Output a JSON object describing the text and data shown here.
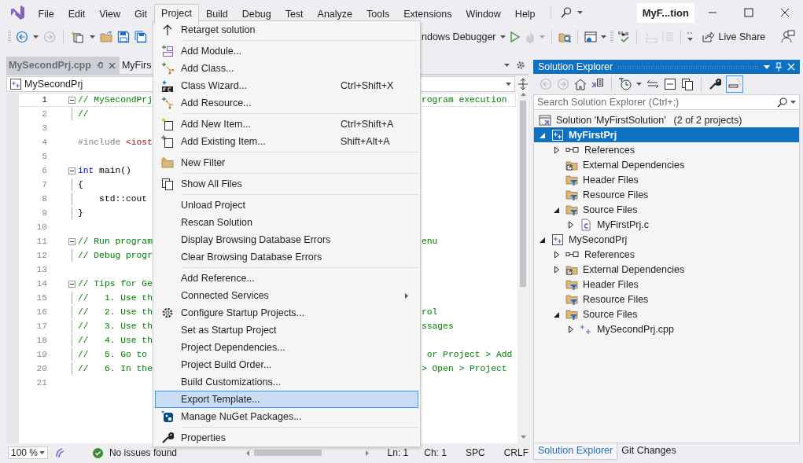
{
  "title_bar": {
    "menus": [
      {
        "label": "File",
        "selected": false
      },
      {
        "label": "Edit",
        "selected": false
      },
      {
        "label": "View",
        "selected": false
      },
      {
        "label": "Git",
        "selected": false
      },
      {
        "label": "Project",
        "selected": true
      },
      {
        "label": "Build",
        "selected": false
      },
      {
        "label": "Debug",
        "selected": false
      },
      {
        "label": "Test",
        "selected": false
      },
      {
        "label": "Analyze",
        "selected": false
      },
      {
        "label": "Tools",
        "selected": false
      },
      {
        "label": "Extensions",
        "selected": false
      },
      {
        "label": "Window",
        "selected": false
      },
      {
        "label": "Help",
        "selected": false
      }
    ],
    "title": "MyF...tion"
  },
  "toolbar": {
    "debug_target": "ndows Debugger",
    "live_share": "Live Share"
  },
  "document_tabs": [
    {
      "label": "MySecondPrj.cpp",
      "selected": true
    },
    {
      "label": "MyFirs",
      "selected": false
    }
  ],
  "navigation_bar": {
    "scope": "MySecondPrj"
  },
  "editor": {
    "lines": [
      {
        "number": "1",
        "current": true,
        "fold": true,
        "left": [
          {
            "text": "// MySecondPrj",
            "kind": "comment"
          }
        ],
        "right": [
          {
            "text": "rogram execution",
            "kind": "comment"
          }
        ]
      },
      {
        "number": "2",
        "current": false,
        "fold": false,
        "left": [
          {
            "text": "//",
            "kind": "comment"
          }
        ]
      },
      {
        "number": "3",
        "current": false,
        "fold": false
      },
      {
        "number": "4",
        "current": false,
        "fold": false,
        "left": [
          {
            "text": "#include ",
            "kind": "preprocessor"
          },
          {
            "text": "<iost",
            "kind": "string"
          }
        ]
      },
      {
        "number": "5",
        "current": false,
        "fold": false
      },
      {
        "number": "6",
        "current": false,
        "fold": true,
        "left": [
          {
            "text": "int",
            "kind": "keyword"
          },
          {
            "text": " main()",
            "kind": "plain"
          }
        ]
      },
      {
        "number": "7",
        "current": false,
        "fold": false,
        "left": [
          {
            "text": "{",
            "kind": "plain"
          }
        ]
      },
      {
        "number": "8",
        "current": false,
        "fold": false,
        "left": [
          {
            "text": "    std::cout",
            "kind": "plain"
          }
        ]
      },
      {
        "number": "9",
        "current": false,
        "fold": false,
        "left": [
          {
            "text": "}",
            "kind": "plain"
          }
        ]
      },
      {
        "number": "10",
        "current": false,
        "fold": false
      },
      {
        "number": "11",
        "current": false,
        "fold": true,
        "left": [
          {
            "text": "// Run program",
            "kind": "comment"
          }
        ],
        "right": [
          {
            "text": "enu",
            "kind": "comment"
          }
        ]
      },
      {
        "number": "12",
        "current": false,
        "fold": false,
        "left": [
          {
            "text": "// Debug progr",
            "kind": "comment"
          }
        ]
      },
      {
        "number": "13",
        "current": false,
        "fold": false
      },
      {
        "number": "14",
        "current": false,
        "fold": true,
        "left": [
          {
            "text": "// Tips for Ge",
            "kind": "comment"
          }
        ]
      },
      {
        "number": "15",
        "current": false,
        "fold": false,
        "left": [
          {
            "text": "//   1. Use th",
            "kind": "comment"
          }
        ]
      },
      {
        "number": "16",
        "current": false,
        "fold": false,
        "left": [
          {
            "text": "//   2. Use th",
            "kind": "comment"
          }
        ],
        "right": [
          {
            "text": "rol",
            "kind": "comment"
          }
        ]
      },
      {
        "number": "17",
        "current": false,
        "fold": false,
        "left": [
          {
            "text": "//   3. Use th",
            "kind": "comment"
          }
        ],
        "right": [
          {
            "text": "ssages",
            "kind": "comment"
          }
        ]
      },
      {
        "number": "18",
        "current": false,
        "fold": false,
        "left": [
          {
            "text": "//   4. Use th",
            "kind": "comment"
          }
        ]
      },
      {
        "number": "19",
        "current": false,
        "fold": false,
        "left": [
          {
            "text": "//   5. Go to",
            "kind": "comment"
          }
        ],
        "right": [
          {
            "text": " or Project > Add",
            "kind": "comment"
          }
        ]
      },
      {
        "number": "20",
        "current": false,
        "fold": false,
        "left": [
          {
            "text": "//   6. In the",
            "kind": "comment"
          }
        ],
        "right": [
          {
            "text": "> Open > Project",
            "kind": "comment"
          }
        ]
      },
      {
        "number": "21",
        "current": false,
        "fold": false
      }
    ]
  },
  "status_bar": {
    "zoom": "100 %",
    "issues": "No issues found",
    "line": "Ln: 1",
    "column": "Ch: 1",
    "indent": "SPC",
    "line_ending": "CRLF"
  },
  "project_menu": {
    "items": [
      {
        "kind": "item",
        "label": "Retarget solution",
        "submenu": false,
        "selected": false
      },
      {
        "kind": "separator"
      },
      {
        "kind": "item",
        "label": "Add Module...",
        "submenu": false,
        "selected": false
      },
      {
        "kind": "item",
        "label": "Add Class...",
        "submenu": false,
        "selected": false
      },
      {
        "kind": "item",
        "label": "Class Wizard...",
        "shortcut": "Ctrl+Shift+X",
        "submenu": false,
        "selected": false
      },
      {
        "kind": "item",
        "label": "Add Resource...",
        "submenu": false,
        "selected": false
      },
      {
        "kind": "separator"
      },
      {
        "kind": "item",
        "label": "Add New Item...",
        "shortcut": "Ctrl+Shift+A",
        "submenu": false,
        "selected": false
      },
      {
        "kind": "item",
        "label": "Add Existing Item...",
        "shortcut": "Shift+Alt+A",
        "submenu": false,
        "selected": false
      },
      {
        "kind": "separator"
      },
      {
        "kind": "item",
        "label": "New Filter",
        "submenu": false,
        "selected": false
      },
      {
        "kind": "separator"
      },
      {
        "kind": "item",
        "label": "Show All Files",
        "submenu": false,
        "selected": false
      },
      {
        "kind": "separator"
      },
      {
        "kind": "item",
        "label": "Unload Project",
        "submenu": false,
        "selected": false
      },
      {
        "kind": "item",
        "label": "Rescan Solution",
        "submenu": false,
        "selected": false
      },
      {
        "kind": "item",
        "label": "Display Browsing Database Errors",
        "submenu": false,
        "selected": false
      },
      {
        "kind": "item",
        "label": "Clear Browsing Database Errors",
        "submenu": false,
        "selected": false
      },
      {
        "kind": "separator"
      },
      {
        "kind": "item",
        "label": "Add Reference...",
        "submenu": false,
        "selected": false
      },
      {
        "kind": "item",
        "label": "Connected Services",
        "submenu": true,
        "selected": false
      },
      {
        "kind": "item",
        "label": "Configure Startup Projects...",
        "submenu": false,
        "selected": false
      },
      {
        "kind": "item",
        "label": "Set as Startup Project",
        "submenu": false,
        "selected": false
      },
      {
        "kind": "item",
        "label": "Project Dependencies...",
        "submenu": false,
        "selected": false
      },
      {
        "kind": "item",
        "label": "Project Build Order...",
        "submenu": false,
        "selected": false
      },
      {
        "kind": "item",
        "label": "Build Customizations...",
        "submenu": false,
        "selected": false
      },
      {
        "kind": "item",
        "label": "Export Template...",
        "submenu": false,
        "selected": true
      },
      {
        "kind": "item",
        "label": "Manage NuGet Packages...",
        "submenu": false,
        "selected": false
      },
      {
        "kind": "separator"
      },
      {
        "kind": "item",
        "label": "Properties",
        "submenu": false,
        "selected": false
      }
    ]
  },
  "solution_explorer": {
    "title": "Solution Explorer",
    "search": {
      "placeholder": "Search Solution Explorer (Ctrl+;)"
    },
    "tree": [
      {
        "label": "Solution 'MyFirstSolution'",
        "detail": "(2 of 2 projects)",
        "kind": "solution",
        "selected": false,
        "children": [
          {
            "label": "MyFirstPrj",
            "kind": "project",
            "startup_project": true,
            "expanded": true,
            "selected": true,
            "children": [
              {
                "label": "References",
                "kind": "references",
                "expanded": false,
                "selected": false
              },
              {
                "label": "External Dependencies",
                "kind": "external",
                "selected": false
              },
              {
                "label": "Header Files",
                "kind": "filter",
                "selected": false
              },
              {
                "label": "Resource Files",
                "kind": "filter",
                "selected": false
              },
              {
                "label": "Source Files",
                "kind": "filter",
                "expanded": true,
                "selected": false,
                "children": [
                  {
                    "label": "MyFirstPrj.c",
                    "kind": "file_c",
                    "expanded": false,
                    "selected": false
                  }
                ]
              }
            ]
          },
          {
            "label": "MySecondPrj",
            "kind": "project",
            "startup_project": false,
            "expanded": true,
            "selected": false,
            "children": [
              {
                "label": "References",
                "kind": "references",
                "expanded": false,
                "selected": false
              },
              {
                "label": "External Dependencies",
                "kind": "external",
                "expanded": false,
                "selected": false
              },
              {
                "label": "Header Files",
                "kind": "filter",
                "selected": false
              },
              {
                "label": "Resource Files",
                "kind": "filter",
                "selected": false
              },
              {
                "label": "Source Files",
                "kind": "filter",
                "expanded": true,
                "selected": false,
                "children": [
                  {
                    "label": "MySecondPrj.cpp",
                    "kind": "file_cpp",
                    "expanded": false,
                    "selected": false
                  }
                ]
              }
            ]
          }
        ]
      }
    ],
    "tabs": [
      {
        "label": "Solution Explorer",
        "selected": true
      },
      {
        "label": "Git Changes",
        "selected": false
      }
    ]
  }
}
